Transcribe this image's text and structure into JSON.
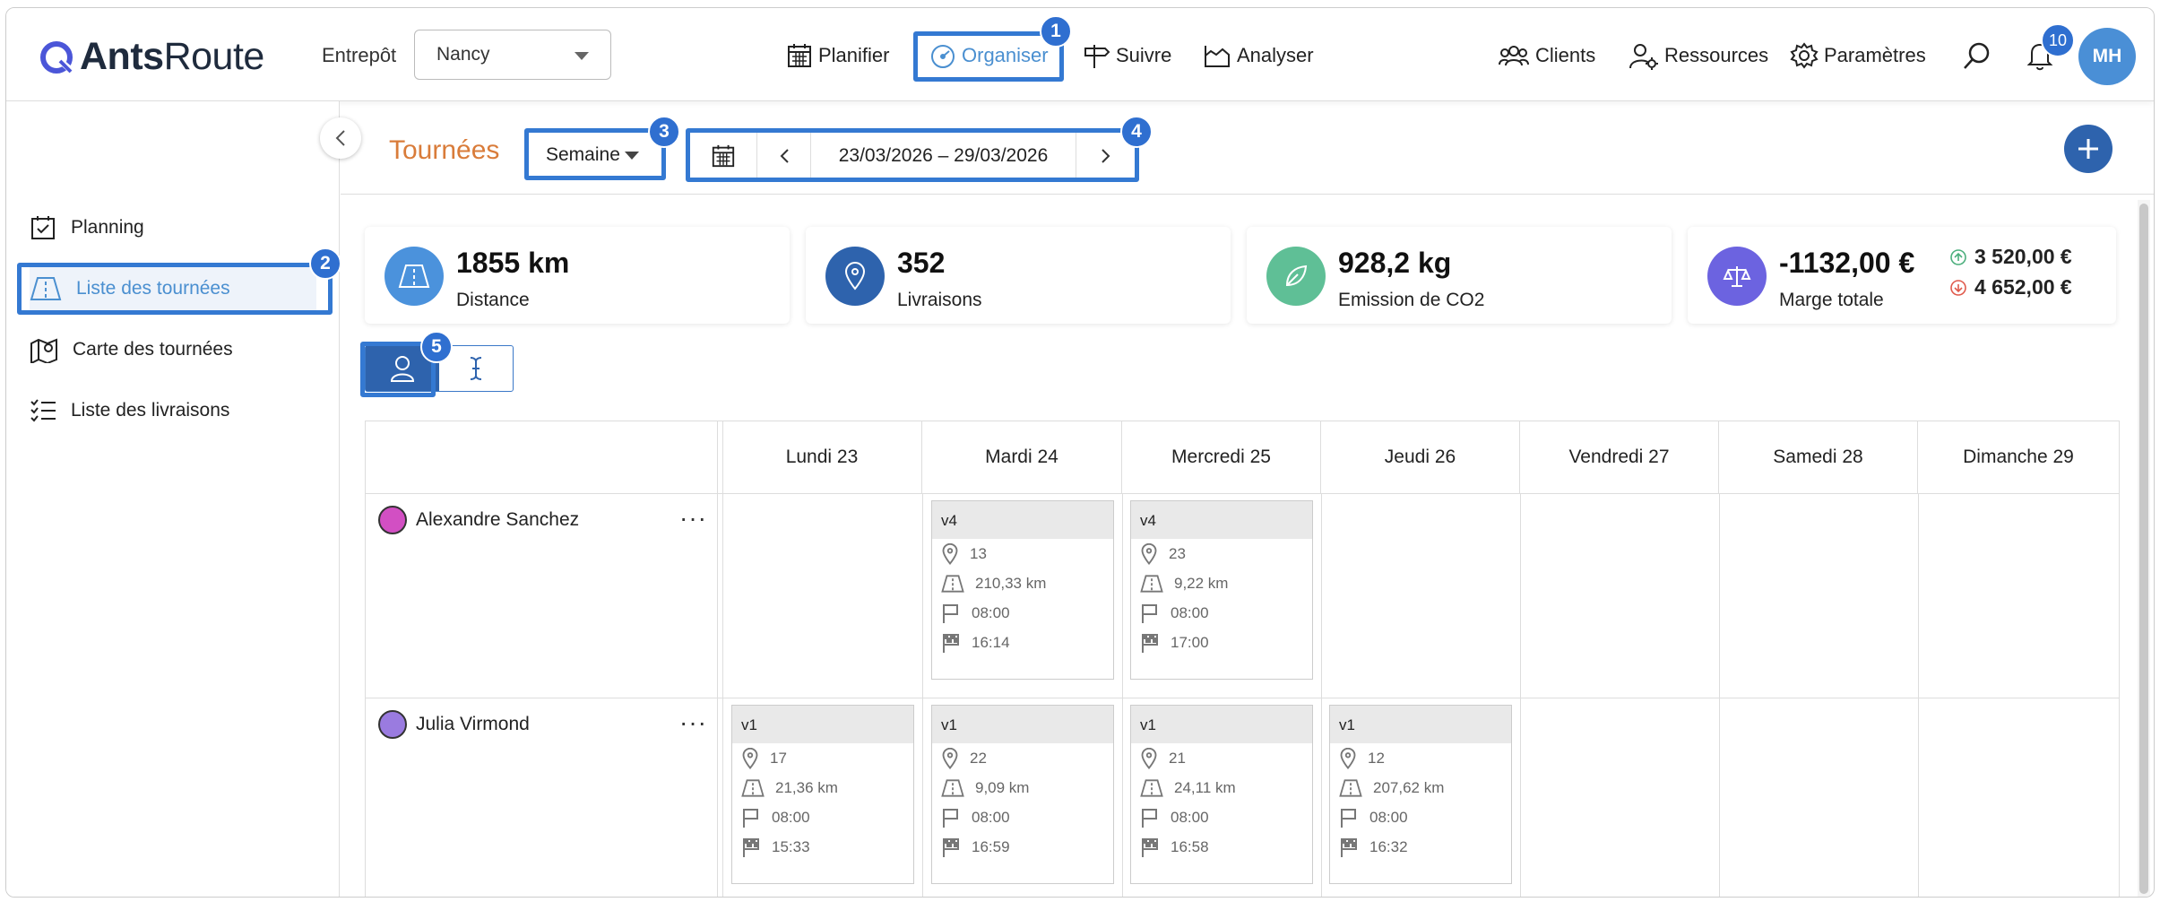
{
  "header": {
    "logo_main": "Ants",
    "logo_light": "Route",
    "entrepot_label": "Entrepôt",
    "entrepot_value": "Nancy",
    "nav": {
      "planifier": "Planifier",
      "organiser": "Organiser",
      "suivre": "Suivre",
      "analyser": "Analyser",
      "clients": "Clients",
      "ressources": "Ressources",
      "parametres": "Paramètres"
    },
    "notifications": "10",
    "avatar": "MH"
  },
  "annotations": {
    "b1": "1",
    "b2": "2",
    "b3": "3",
    "b4": "4",
    "b5": "5"
  },
  "sidebar": {
    "items": [
      {
        "label": "Planning"
      },
      {
        "label": "Liste des tournées"
      },
      {
        "label": "Carte des tournées"
      },
      {
        "label": "Liste des livraisons"
      }
    ]
  },
  "toolbar": {
    "title": "Tournées",
    "period": "Semaine",
    "date_range": "23/03/2026 – 29/03/2026"
  },
  "stats": [
    {
      "value": "1855 km",
      "label": "Distance"
    },
    {
      "value": "352",
      "label": "Livraisons"
    },
    {
      "value": "928,2 kg",
      "label": "Emission de CO2"
    },
    {
      "value": "-1132,00 €",
      "label": "Marge totale",
      "up": "3 520,00 €",
      "down": "4 652,00 €"
    }
  ],
  "colors": {
    "accent": "#2e63ad",
    "title": "#d97c3a",
    "link": "#4a8fd0",
    "annot": "#3479d2"
  },
  "calendar": {
    "days": [
      "Lundi 23",
      "Mardi 24",
      "Mercredi 25",
      "Jeudi 26",
      "Vendredi 27",
      "Samedi 28",
      "Dimanche 29"
    ],
    "people": [
      {
        "name": "Alexandre Sanchez",
        "color": "#d24fc3"
      },
      {
        "name": "Julia Virmond",
        "color": "#9a7be0"
      }
    ],
    "tours": {
      "a_mar": {
        "name": "v4",
        "stops": "13",
        "km": "210,33 km",
        "start": "08:00",
        "end": "16:14"
      },
      "a_mer": {
        "name": "v4",
        "stops": "23",
        "km": "9,22 km",
        "start": "08:00",
        "end": "17:00"
      },
      "j_lun": {
        "name": "v1",
        "stops": "17",
        "km": "21,36 km",
        "start": "08:00",
        "end": "15:33"
      },
      "j_mar": {
        "name": "v1",
        "stops": "22",
        "km": "9,09 km",
        "start": "08:00",
        "end": "16:59"
      },
      "j_mer": {
        "name": "v1",
        "stops": "21",
        "km": "24,11 km",
        "start": "08:00",
        "end": "16:58"
      },
      "j_jeu": {
        "name": "v1",
        "stops": "12",
        "km": "207,62 km",
        "start": "08:00",
        "end": "16:32"
      }
    }
  }
}
